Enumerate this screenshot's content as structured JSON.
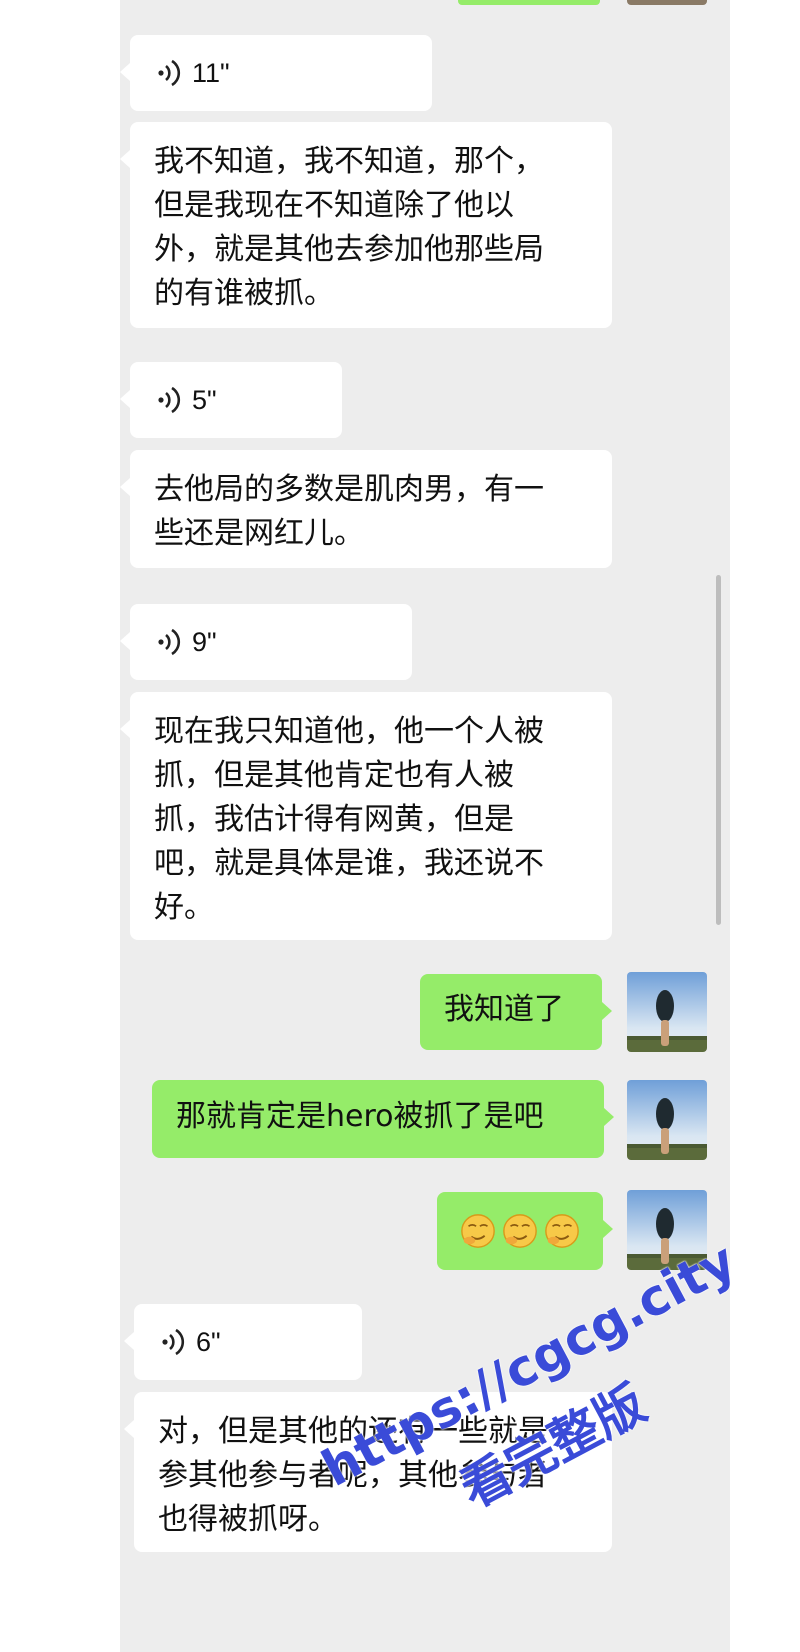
{
  "colors": {
    "background": "#ededed",
    "incoming_bubble": "#ffffff",
    "outgoing_bubble": "#95ec69",
    "watermark": "#3a4bd8"
  },
  "messages": [
    {
      "type": "voice",
      "direction": "incoming",
      "duration": "11\""
    },
    {
      "type": "text",
      "direction": "incoming",
      "lines": [
        "我不知道，我不知道，那个，",
        "但是我现在不知道除了他以",
        "外，就是其他去参加他那些局",
        "的有谁被抓。"
      ]
    },
    {
      "type": "voice",
      "direction": "incoming",
      "duration": "5\""
    },
    {
      "type": "text",
      "direction": "incoming",
      "lines": [
        "去他局的多数是肌肉男，有一",
        "些还是网红儿。"
      ]
    },
    {
      "type": "voice",
      "direction": "incoming",
      "duration": "9\""
    },
    {
      "type": "text",
      "direction": "incoming",
      "lines": [
        "现在我只知道他，他一个人被",
        "抓，但是其他肯定也有人被",
        "抓，我估计得有网黄，但是",
        "吧，就是具体是谁，我还说不",
        "好。"
      ]
    },
    {
      "type": "text",
      "direction": "outgoing",
      "lines": [
        "我知道了"
      ]
    },
    {
      "type": "text",
      "direction": "outgoing",
      "lines": [
        "那就肯定是hero被抓了是吧"
      ]
    },
    {
      "type": "emoji",
      "direction": "outgoing",
      "emojis": [
        "smirk-face-emoji",
        "smirk-face-emoji",
        "smirk-face-emoji"
      ]
    },
    {
      "type": "voice",
      "direction": "incoming",
      "duration": "6\""
    },
    {
      "type": "text",
      "direction": "incoming",
      "lines": [
        "对，但是其他的还有一些就是",
        "参其他参与者呢，其他参与者",
        "也得被抓呀。"
      ]
    }
  ],
  "watermark": {
    "line1": "https://cgcg.city",
    "line2": "看完整版"
  }
}
